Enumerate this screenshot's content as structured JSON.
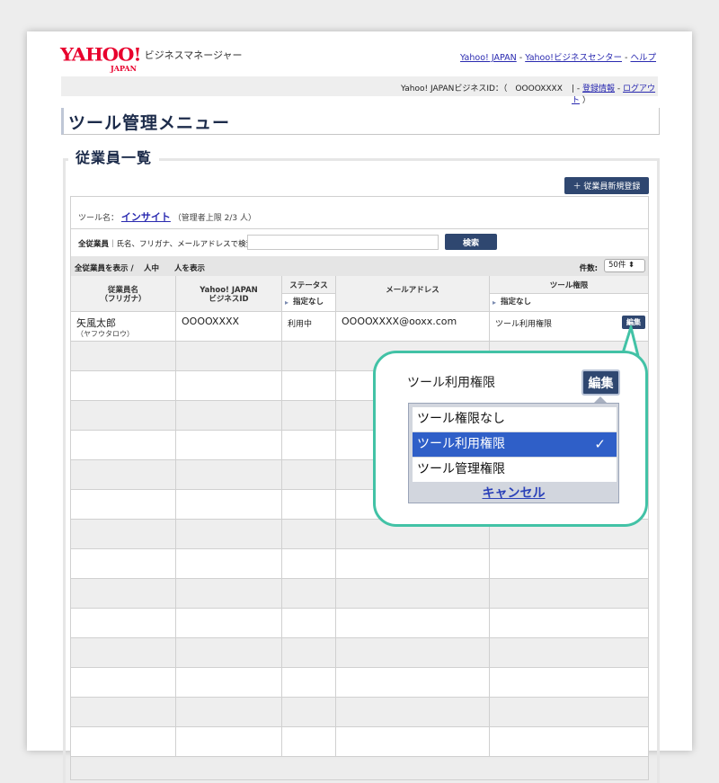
{
  "header": {
    "logo_text": "YAHOO!",
    "logo_sub": "JAPAN",
    "service_name": "ビジネスマネージャー",
    "links": [
      "Yahoo! JAPAN",
      "Yahoo!ビジネスセンター",
      "ヘルプ"
    ],
    "link_sep": "-"
  },
  "id_bar": {
    "id_label": "Yahoo! JAPANビジネスID：（　OOOOXXXX",
    "register_link": "登録情報",
    "logout_link": "ログアウト",
    "close_paren": "）"
  },
  "page_title": "ツール管理メニュー",
  "section_title": "従業員一覧",
  "new_employee_button": "＋ 従業員新規登録",
  "tool_info": {
    "label": "ツール名：",
    "tool_name": "インサイト",
    "limit": "（管理者上限 2/3 人）"
  },
  "search": {
    "label_bold": "全従業員",
    "label_rest": "｜氏名、フリガナ、メールアドレスで検索",
    "value": "",
    "button": "検索"
  },
  "filter": {
    "left_text": "全従業員を表示 /　 人中　　人を表示",
    "count_label": "件数:",
    "count_value": "50件 ⬍"
  },
  "table": {
    "headers": {
      "name": "従業員名\n（フリガナ）",
      "bizid": "Yahoo! JAPAN\nビジネスID",
      "status": "ステータス",
      "status_filter": "指定なし",
      "email": "メールアドレス",
      "permission": "ツール権限",
      "permission_filter": "指定なし"
    },
    "rows": [
      {
        "name": "矢風太郎",
        "kana": "（ヤフウタロウ）",
        "bizid": "OOOOXXXX",
        "status": "利用中",
        "email": "OOOOXXXX@ooxx.com",
        "permission": "ツール利用権限",
        "edit": "編集"
      }
    ]
  },
  "callout": {
    "title": "ツール利用権限",
    "edit_button": "編集",
    "options": [
      "ツール権限なし",
      "ツール利用権限",
      "ツール管理権限"
    ],
    "selected_index": 1,
    "check_mark": "✓",
    "cancel": "キャンセル"
  },
  "colors": {
    "brand_red": "#e8002d",
    "navy_button": "#2f4770",
    "callout_teal": "#42c2a6",
    "selected_blue": "#2f5fc8"
  }
}
